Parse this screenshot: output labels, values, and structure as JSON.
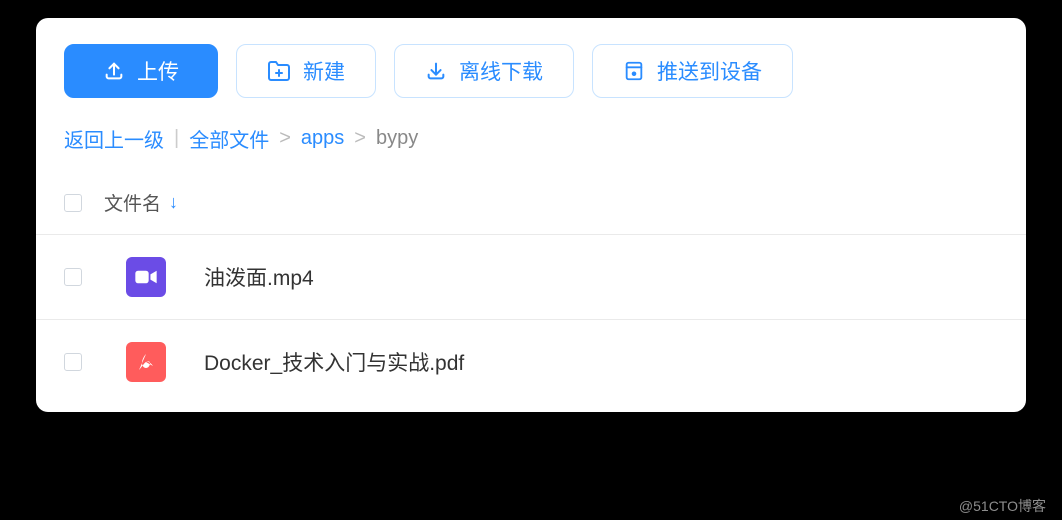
{
  "toolbar": {
    "upload": "上传",
    "new": "新建",
    "offline_download": "离线下载",
    "push_device": "推送到设备"
  },
  "breadcrumb": {
    "back": "返回上一级",
    "root": "全部文件",
    "path": [
      "apps"
    ],
    "current": "bypy"
  },
  "columns": {
    "name": "文件名"
  },
  "files": [
    {
      "name": "油泼面.mp4",
      "type": "video"
    },
    {
      "name": "Docker_技术入门与实战.pdf",
      "type": "pdf"
    }
  ],
  "watermark": "@51CTO博客"
}
